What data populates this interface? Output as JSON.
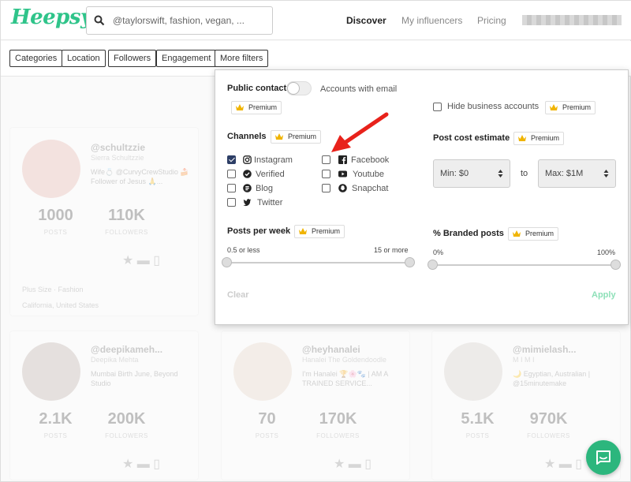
{
  "logo": "Heepsy",
  "search": {
    "placeholder": "@taylorswift, fashion, vegan, ..."
  },
  "nav": {
    "discover": "Discover",
    "my_influencers": "My influencers",
    "pricing": "Pricing"
  },
  "filters": [
    "Categories",
    "Location",
    "Followers",
    "Engagement",
    "More filters"
  ],
  "cards": [
    {
      "handle": "@schultzzie",
      "name": "Sierra Schultzzie",
      "desc": "Wife💍 @CurvyCrewStudio 🍰 Follower of Jesus 🙏...",
      "posts": "1000",
      "followers": "110K",
      "tags": [
        "Plus Size",
        "Fashion"
      ],
      "location": "California, United States"
    },
    {
      "handle": "@deepikameh...",
      "name": "Deepika Mehta",
      "desc": "Mumbai Birth June, Beyond Studio",
      "posts": "2.1K",
      "followers": "200K"
    },
    {
      "handle": "@heyhanalei",
      "name": "Hanalei The Goldendoodle",
      "desc": "I'm Hanalei 🏆🌸🐾 | AM A TRAINED SERVICE...",
      "posts": "70",
      "followers": "170K"
    },
    {
      "handle": "@mimielash...",
      "name": "M I M I",
      "desc": "🌙 Egyptian, Australian | @15minutemake",
      "posts": "5.1K",
      "followers": "970K"
    }
  ],
  "stat_labels": {
    "posts": "POSTS",
    "followers": "FOLLOWERS"
  },
  "modal": {
    "public_contact": "Public contact",
    "accounts_with_email": "Accounts with email",
    "premium": "Premium",
    "hide_business": "Hide business accounts",
    "channels": "Channels",
    "channel_items": [
      {
        "label": "Instagram",
        "checked": true
      },
      {
        "label": "Verified",
        "checked": false
      },
      {
        "label": "Blog",
        "checked": false
      },
      {
        "label": "Twitter",
        "checked": false
      },
      {
        "label": "Facebook",
        "checked": false
      },
      {
        "label": "Youtube",
        "checked": false
      },
      {
        "label": "Snapchat",
        "checked": false
      }
    ],
    "post_cost": "Post cost estimate",
    "min_value": "Min: $0",
    "to": "to",
    "max_value": "Max: $1M",
    "posts_per_week": "Posts per week",
    "ppw_min": "0.5 or less",
    "ppw_max": "15 or more",
    "branded": "% Branded posts",
    "branded_min": "0%",
    "branded_max": "100%",
    "clear": "Clear",
    "apply": "Apply"
  },
  "colors": {
    "brand": "#2fc48a",
    "checkbox": "#2d3e66",
    "arrow": "#e8221b",
    "crown": "#f0b400"
  }
}
